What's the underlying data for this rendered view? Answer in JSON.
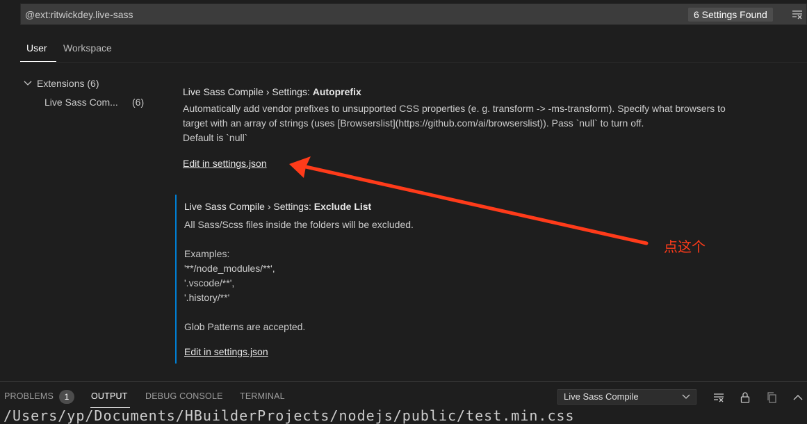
{
  "search": {
    "query": "@ext:ritwickdey.live-sass",
    "results": "6 Settings Found"
  },
  "tabs": [
    {
      "label": "User"
    },
    {
      "label": "Workspace"
    }
  ],
  "toc": {
    "extensions_label": "Extensions (6)",
    "live_sass_label": "Live Sass Com...",
    "live_sass_count": "(6)"
  },
  "settings": [
    {
      "prefix": "Live Sass Compile › Settings: ",
      "key": "Autoprefix",
      "description": "Automatically add vendor prefixes to unsupported CSS properties (e. g. transform -> -ms-transform). Specify what browsers to\ntarget with an array of strings (uses [Browserslist](https://github.com/ai/browserslist)). Pass `null` to turn off.\nDefault is `null`",
      "edit_link": "Edit in settings.json"
    },
    {
      "prefix": "Live Sass Compile › Settings: ",
      "key": "Exclude List",
      "description": "All Sass/Scss files inside the folders will be excluded.\n\nExamples:\n'**/node_modules/**',\n'.vscode/**',\n'.history/**'\n\nGlob Patterns are accepted.",
      "edit_link": "Edit in settings.json"
    }
  ],
  "annotation": {
    "text": "点这个",
    "color": "#ff3b1a"
  },
  "panel": {
    "tabs": [
      {
        "label": "PROBLEMS"
      },
      {
        "label": "OUTPUT"
      },
      {
        "label": "DEBUG CONSOLE"
      },
      {
        "label": "TERMINAL"
      }
    ],
    "problems_count": "1",
    "output_channel": "Live Sass Compile",
    "output_text": "/Users/yp/Documents/HBuilderProjects/nodejs/public/test.min.css"
  },
  "colors": {
    "accent": "#007fd4",
    "background": "#1e1e1e"
  }
}
